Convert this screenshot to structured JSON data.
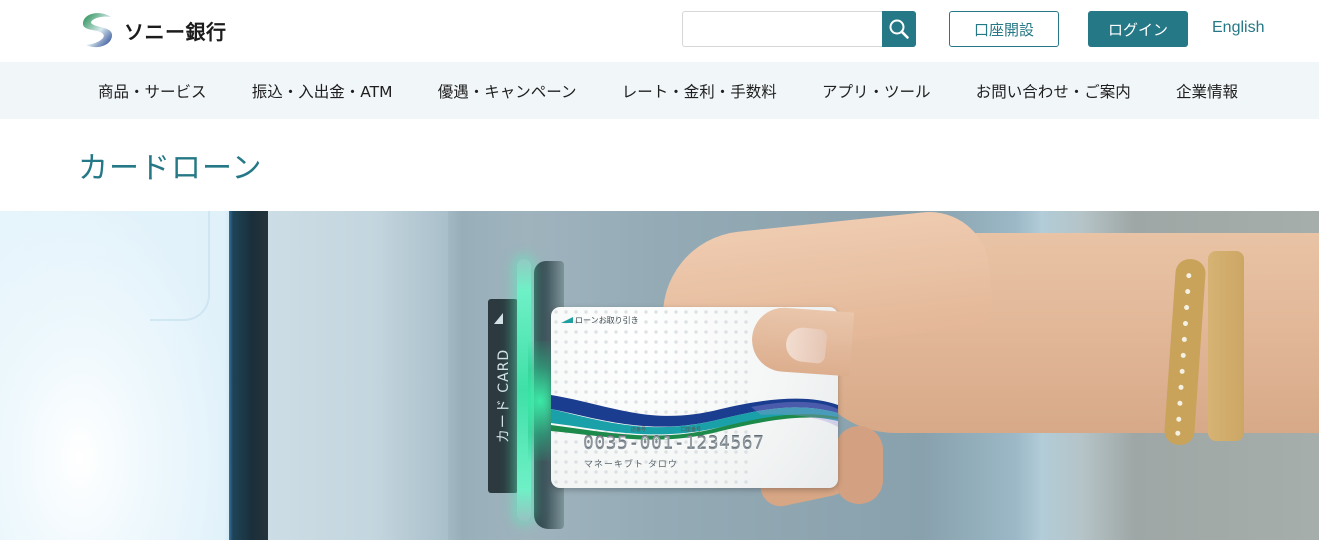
{
  "header": {
    "logo_text": "ソニー銀行",
    "search": {
      "value": "",
      "placeholder": "",
      "button_icon": "search-icon"
    },
    "open_account_label": "口座開設",
    "login_label": "ログイン",
    "english_label": "English"
  },
  "nav": {
    "items": [
      {
        "label": "商品・サービス"
      },
      {
        "label": "振込・入出金・ATM"
      },
      {
        "label": "優遇・キャンペーン"
      },
      {
        "label": "レート・金利・手数料"
      },
      {
        "label": "アプリ・ツール"
      },
      {
        "label": "お問い合わせ・ご案内"
      },
      {
        "label": "企業情報"
      }
    ]
  },
  "page": {
    "title": "カードローン"
  },
  "hero": {
    "slot_label": "カード CARD",
    "card": {
      "label": "ローンお取り引き",
      "branch_label": "店番号",
      "account_label": "口座番号",
      "number": "0035-001-1234567",
      "holder_name": "マネーキブト タロウ"
    }
  },
  "colors": {
    "brand": "#257886",
    "nav_background": "#f1f6f8",
    "title": "#257886"
  }
}
